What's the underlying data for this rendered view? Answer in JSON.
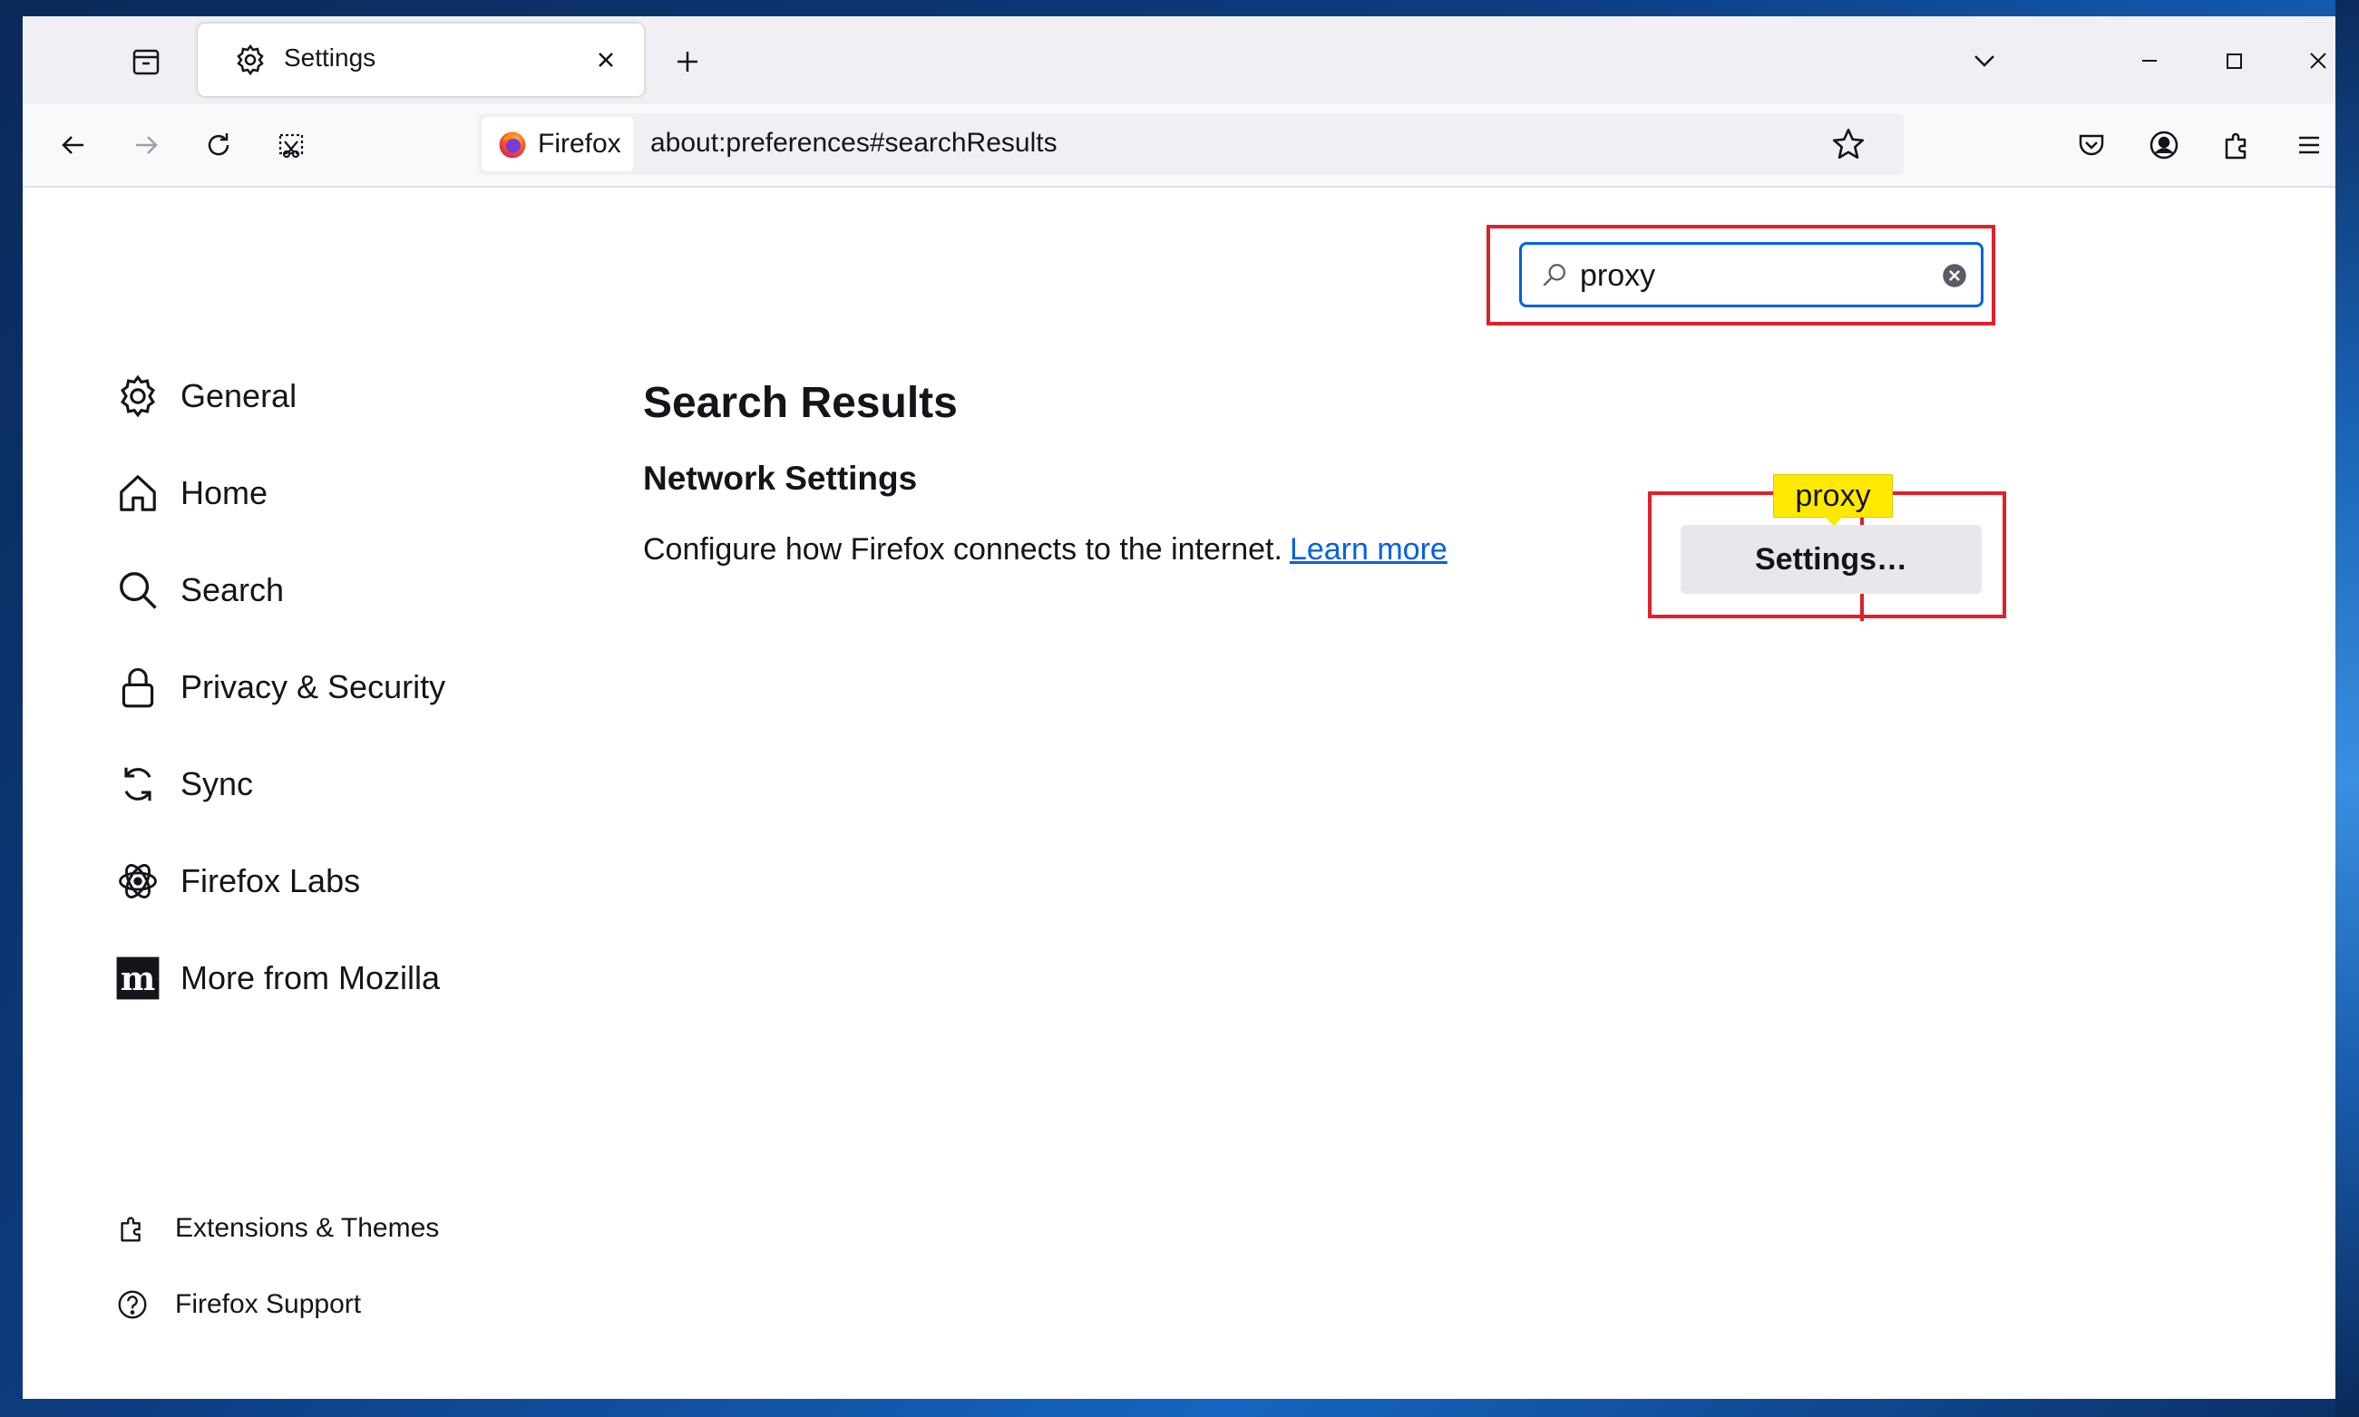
{
  "tab": {
    "title": "Settings"
  },
  "urlbar": {
    "identity_label": "Firefox",
    "url": "about:preferences#searchResults"
  },
  "search": {
    "value": "proxy"
  },
  "sidebar": {
    "items": [
      {
        "label": "General"
      },
      {
        "label": "Home"
      },
      {
        "label": "Search"
      },
      {
        "label": "Privacy & Security"
      },
      {
        "label": "Sync"
      },
      {
        "label": "Firefox Labs"
      },
      {
        "label": "More from Mozilla"
      }
    ],
    "footer": [
      {
        "label": "Extensions & Themes"
      },
      {
        "label": "Firefox Support"
      }
    ]
  },
  "main": {
    "title": "Search Results",
    "section_title": "Network Settings",
    "description": "Configure how Firefox connects to the internet.",
    "learn_more": "Learn more",
    "settings_button": "Settings…",
    "tooltip": "proxy"
  },
  "colors": {
    "accent": "#0061e0",
    "highlight_box": "#e0202a",
    "tooltip_bg": "#ffe900"
  }
}
